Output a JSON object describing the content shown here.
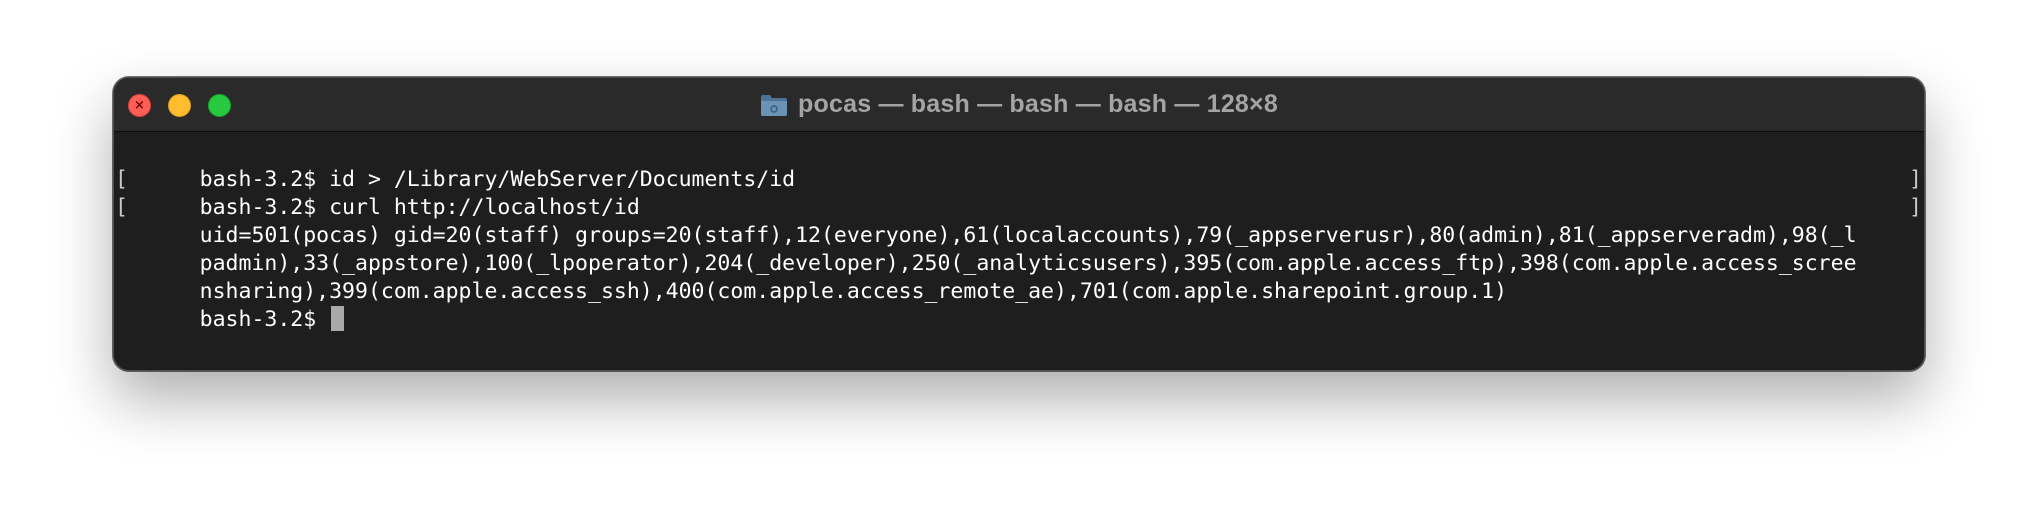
{
  "window": {
    "title": "pocas — bash — bash — bash — 128×8",
    "title_icon": "folder-icon",
    "traffic_lights": {
      "close_color": "#ff5f57",
      "minimize_color": "#febc2e",
      "zoom_color": "#28c840"
    }
  },
  "terminal": {
    "background": "#1e1e1e",
    "foreground": "#ffffff",
    "lines": [
      {
        "text": "bash-3.2$ id > /Library/WebServer/Documents/id",
        "marked": true
      },
      {
        "text": "bash-3.2$ curl http://localhost/id",
        "marked": true
      },
      {
        "text": "uid=501(pocas) gid=20(staff) groups=20(staff),12(everyone),61(localaccounts),79(_appserverusr),80(admin),81(_appserveradm),98(_l",
        "marked": false
      },
      {
        "text": "padmin),33(_appstore),100(_lpoperator),204(_developer),250(_analyticsusers),395(com.apple.access_ftp),398(com.apple.access_scree",
        "marked": false
      },
      {
        "text": "nsharing),399(com.apple.access_ssh),400(com.apple.access_remote_ae),701(com.apple.sharepoint.group.1)",
        "marked": false
      }
    ],
    "prompt": "bash-3.2$ ",
    "cursor": "block"
  }
}
